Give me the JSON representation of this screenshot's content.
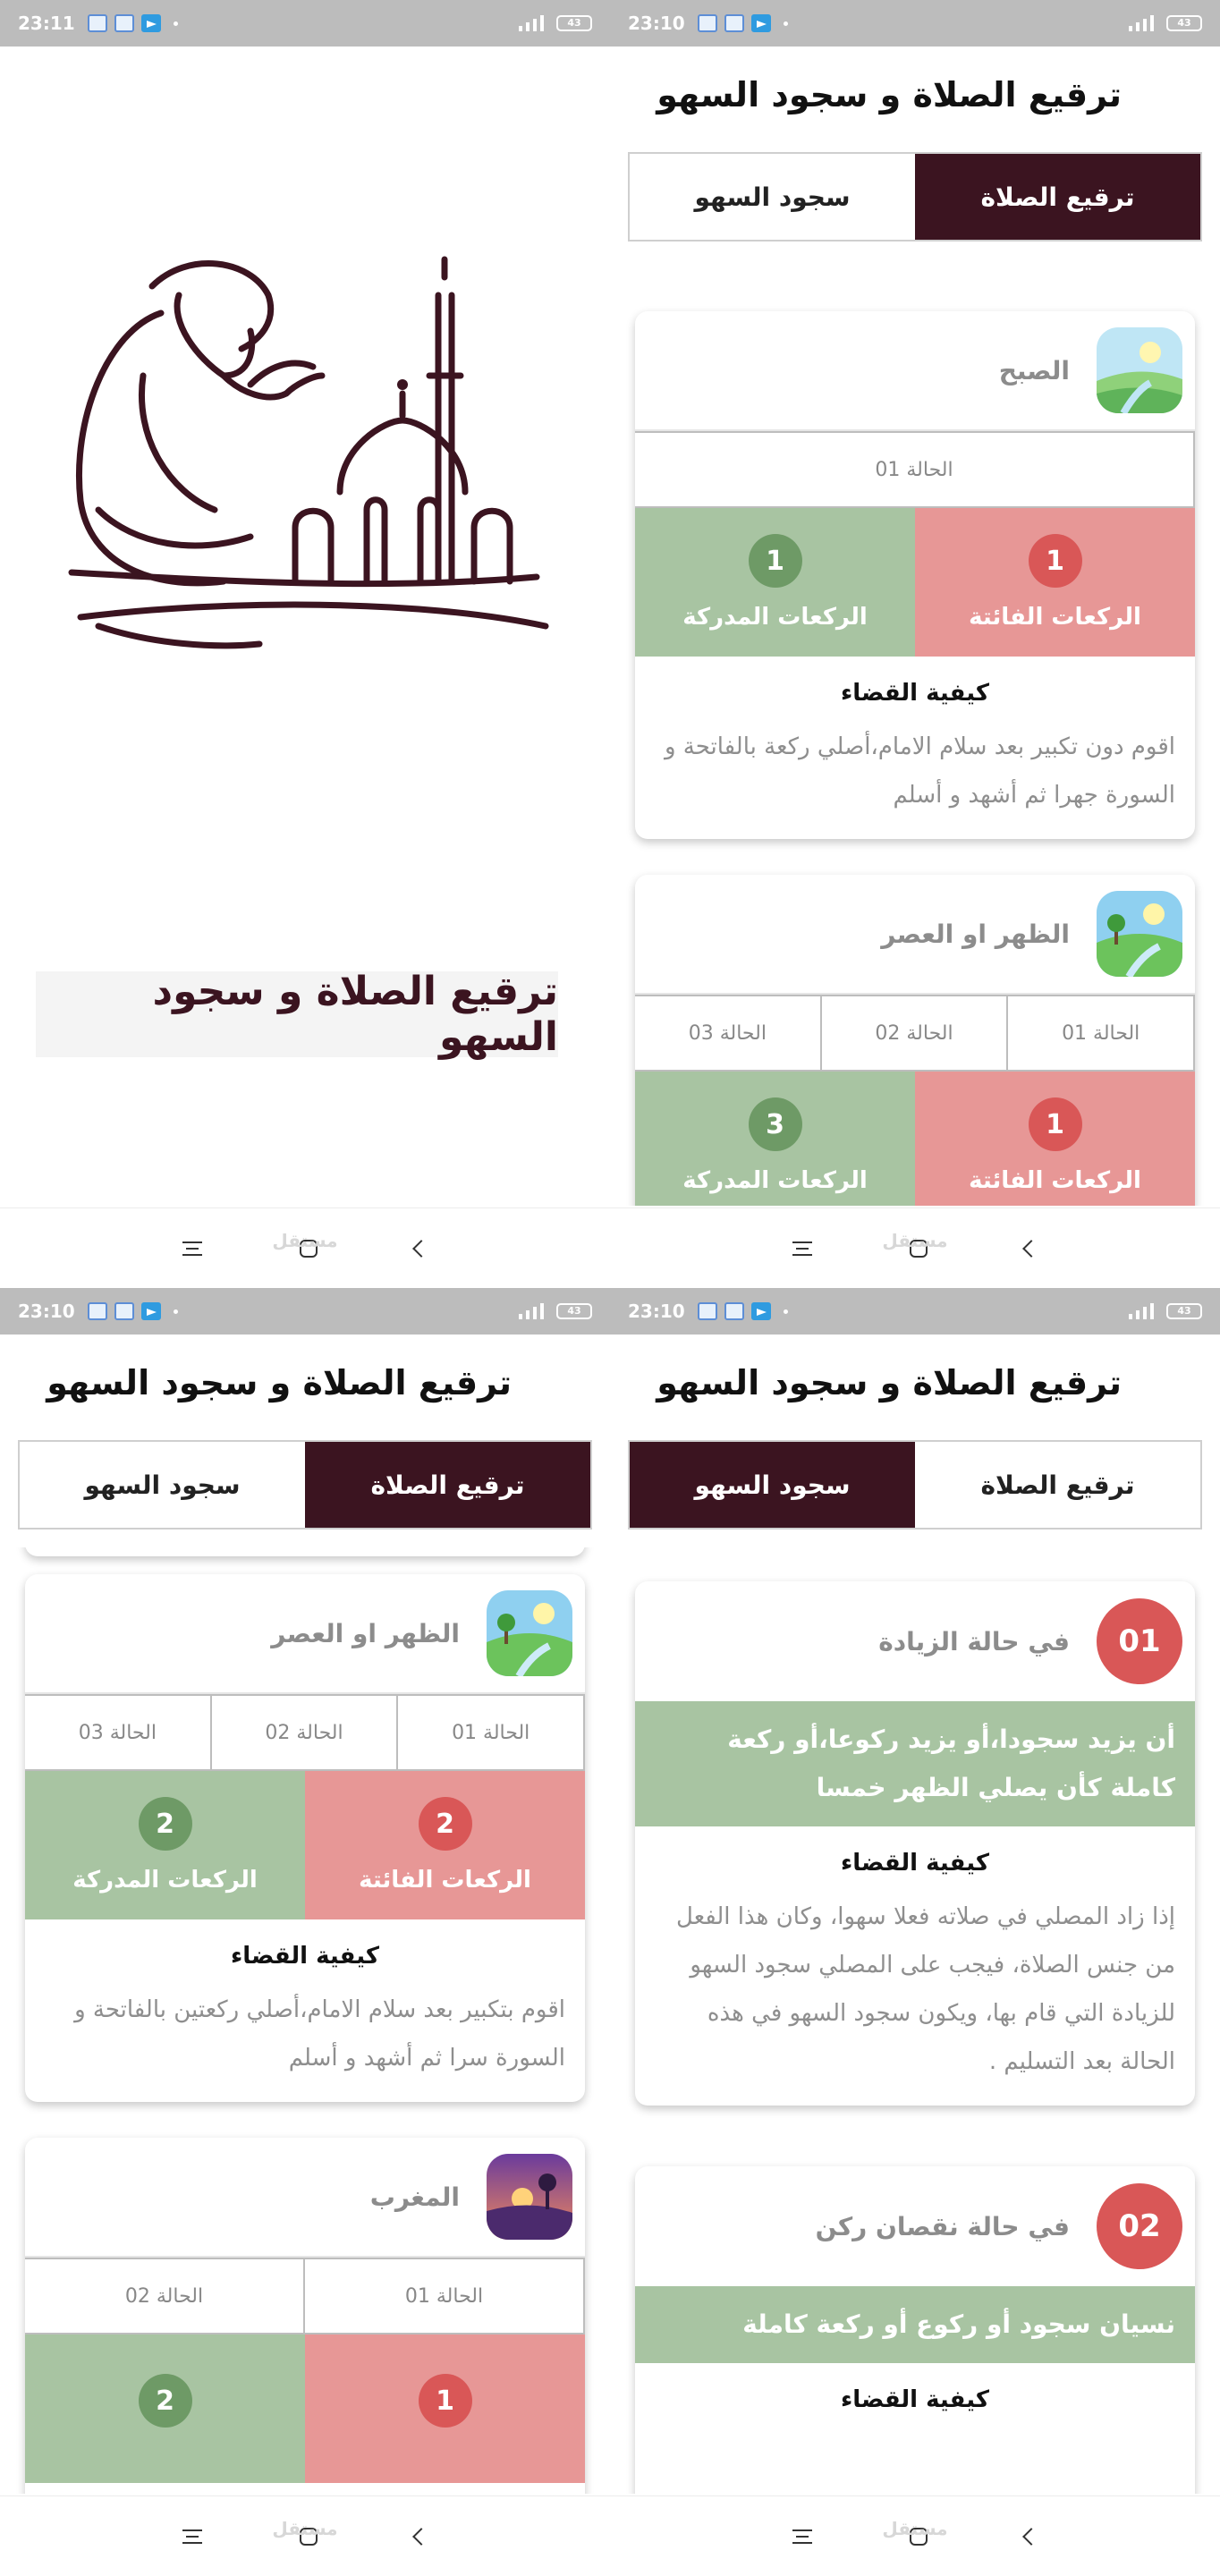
{
  "status": {
    "time_splash": "23:11",
    "time": "23:10",
    "battery": "43"
  },
  "watermark": "مستقل",
  "app_title": "ترقيع الصلاة و سجود السهو",
  "tabs": {
    "prayer": "ترقيع الصلاة",
    "sahw": "سجود السهو"
  },
  "splash_title": "ترقيع الصلاة و سجود السهو",
  "labels": {
    "missed": "الركعات الفائتة",
    "caught": "الركعات المدركة",
    "qada": "كيفية القضاء"
  },
  "screen_b": {
    "fajr": {
      "name": "الصبح",
      "cases": [
        "الحالة 01"
      ],
      "missed": "1",
      "caught": "1",
      "text": "اقوم دون تكبير بعد سلام الامام،أصلي ركعة بالفاتحة و السورة جهرا ثم أشهد و أسلم"
    },
    "dhuhr": {
      "name": "الظهر او العصر",
      "cases": [
        "الحالة 01",
        "الحالة 02",
        "الحالة 03"
      ],
      "missed": "1",
      "caught": "3"
    }
  },
  "screen_c": {
    "dhuhr": {
      "name": "الظهر او العصر",
      "cases": [
        "الحالة 01",
        "الحالة 02",
        "الحالة 03"
      ],
      "missed": "2",
      "caught": "2",
      "text": "اقوم بتكبير بعد سلام الامام،أصلي ركعتين بالفاتحة و السورة سرا ثم أشهد و أسلم"
    },
    "maghrib": {
      "name": "المغرب",
      "cases": [
        "الحالة 01",
        "الحالة 02"
      ],
      "missed": "1",
      "caught": "2"
    }
  },
  "screen_d": {
    "c1": {
      "num": "01",
      "title": "في حالة الزيادة",
      "band": "أن يزيد سجودا،أو يزيد ركوعا،أو ركعة كاملة كأن يصلي الظهر خمسا",
      "text": "إذا زاد المصلي في صلاته فعلا سهوا، وكان هذا الفعل من جنس الصلاة، فيجب على المصلي سجود السهو للزيادة التي قام بها، ويكون سجود السهو في هذه الحالة بعد التسليم ."
    },
    "c2": {
      "num": "02",
      "title": "في حالة نقصان ركن",
      "band": "نسيان سجود أو ركوع أو ركعة كاملة"
    }
  },
  "colors": {
    "primary": "#3b1420",
    "missed": "#e79796",
    "caught": "#a8c4a2"
  }
}
